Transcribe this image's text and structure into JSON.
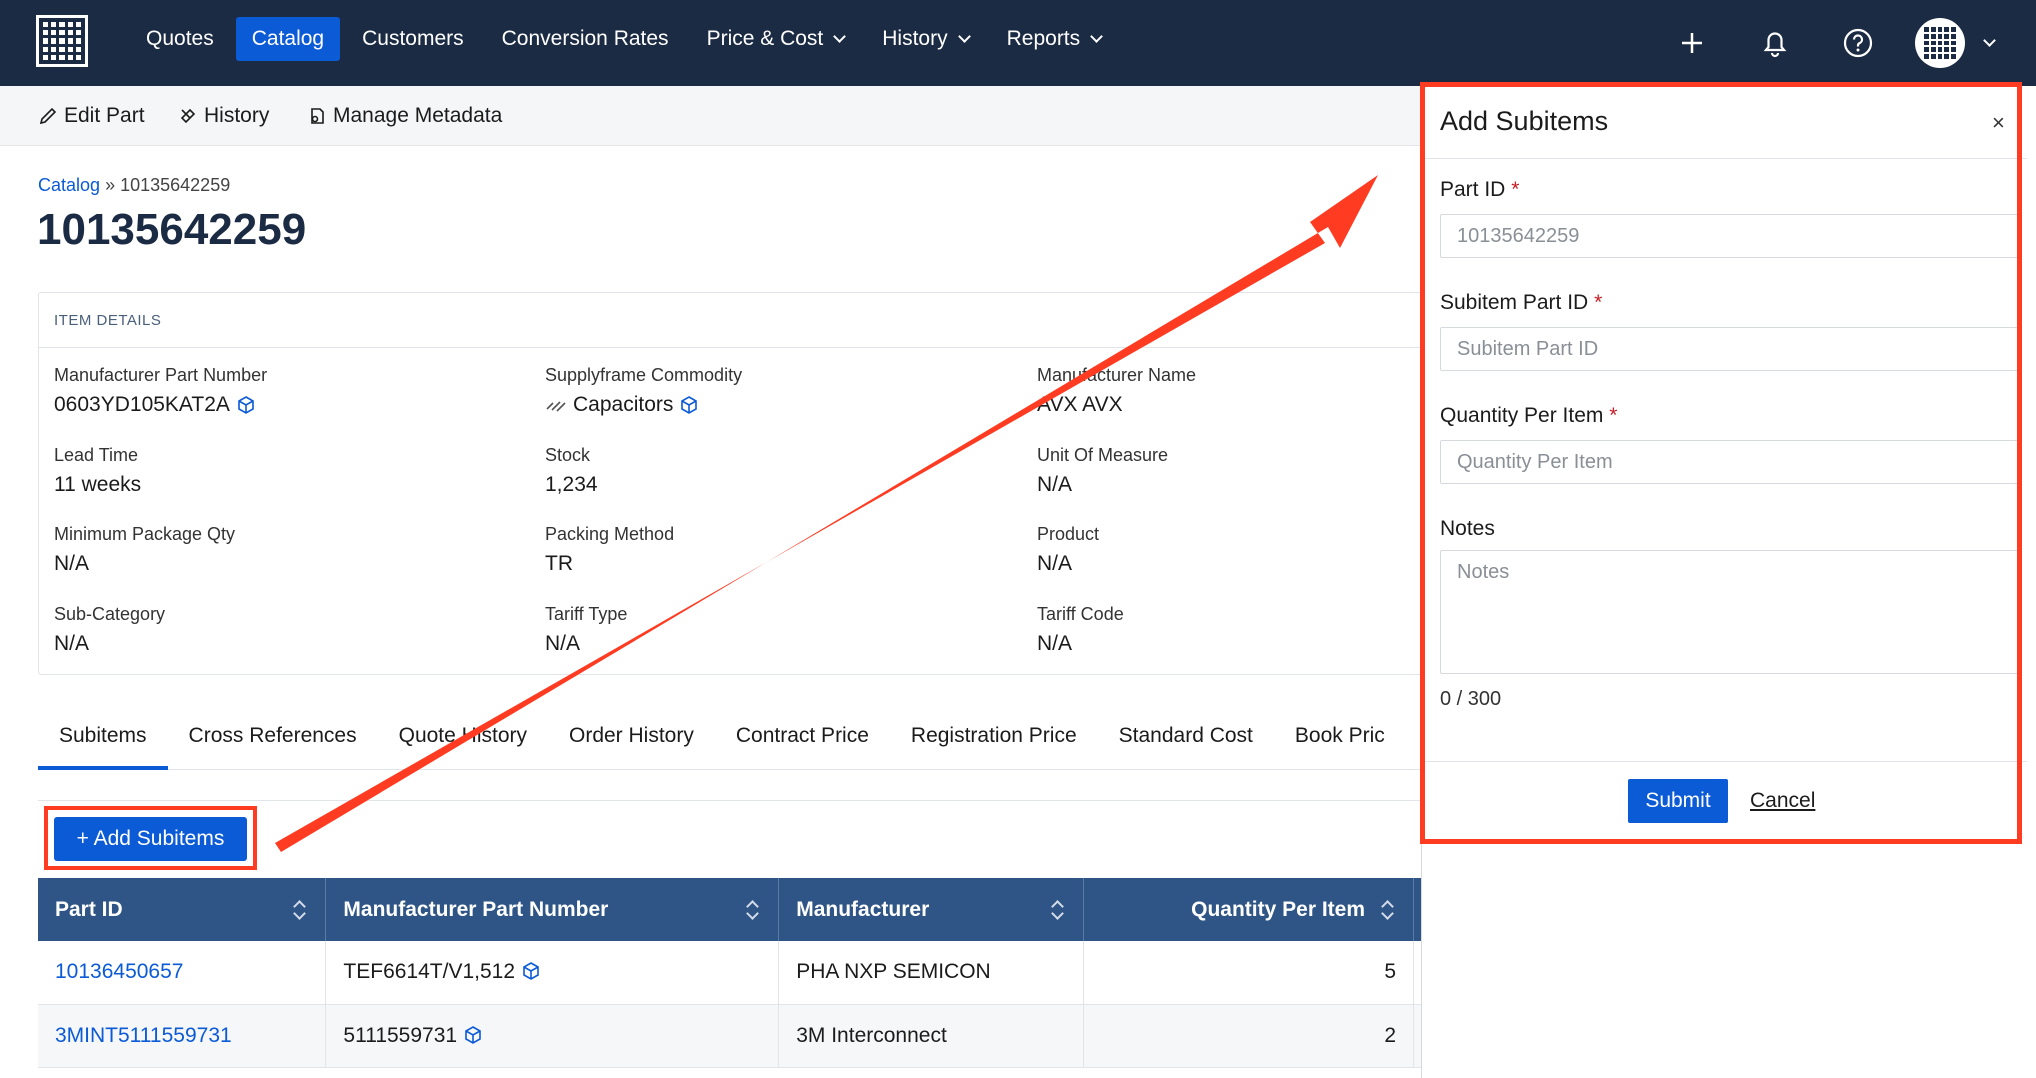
{
  "nav": {
    "links": [
      "Quotes",
      "Catalog",
      "Customers",
      "Conversion Rates",
      "Price & Cost",
      "History",
      "Reports"
    ],
    "active": "Catalog"
  },
  "toolbar": {
    "edit_part": "Edit Part",
    "history": "History",
    "manage_metadata": "Manage Metadata"
  },
  "breadcrumb": {
    "root": "Catalog",
    "sep": "»",
    "current": "10135642259"
  },
  "page_title": "10135642259",
  "item_details": {
    "heading": "ITEM DETAILS",
    "fields": [
      {
        "label": "Manufacturer Part Number",
        "value": "0603YD105KAT2A"
      },
      {
        "label": "Supplyframe Commodity",
        "value": "Capacitors"
      },
      {
        "label": "Manufacturer Name",
        "value": "AVX AVX"
      },
      {
        "label": "Lead Time",
        "value": "11 weeks"
      },
      {
        "label": "Stock",
        "value": "1,234"
      },
      {
        "label": "Unit Of Measure",
        "value": "N/A"
      },
      {
        "label": "Minimum Package Qty",
        "value": "N/A"
      },
      {
        "label": "Packing Method",
        "value": "TR"
      },
      {
        "label": "Product",
        "value": "N/A"
      },
      {
        "label": "Sub-Category",
        "value": "N/A"
      },
      {
        "label": "Tariff Type",
        "value": "N/A"
      },
      {
        "label": "Tariff Code",
        "value": "N/A"
      }
    ]
  },
  "tabs": [
    "Subitems",
    "Cross References",
    "Quote History",
    "Order History",
    "Contract Price",
    "Registration Price",
    "Standard Cost",
    "Book Pric"
  ],
  "add_subitems_label": "+ Add Subitems",
  "table": {
    "headers": [
      "Part ID",
      "Manufacturer Part Number",
      "Manufacturer",
      "Quantity Per Item"
    ],
    "rows": [
      {
        "part_id": "10136450657",
        "mpn": "TEF6614T/V1,512",
        "manufacturer": "PHA NXP SEMICON",
        "qty": "5"
      },
      {
        "part_id": "3MINT5111559731",
        "mpn": "5111559731",
        "manufacturer": "3M Interconnect",
        "qty": "2"
      }
    ]
  },
  "panel": {
    "title": "Add Subitems",
    "close": "×",
    "part_id_label": "Part ID",
    "part_id_value": "10135642259",
    "subitem_label": "Subitem Part ID",
    "subitem_placeholder": "Subitem Part ID",
    "qty_label": "Quantity Per Item",
    "qty_placeholder": "Quantity Per Item",
    "notes_label": "Notes",
    "notes_placeholder": "Notes",
    "counter": "0 / 300",
    "required_mark": "*",
    "submit": "Submit",
    "cancel": "Cancel"
  },
  "colors": {
    "nav_bg": "#1c2b44",
    "accent": "#0b5ad6",
    "highlight": "#ff3b22",
    "table_header": "#2f5587"
  }
}
